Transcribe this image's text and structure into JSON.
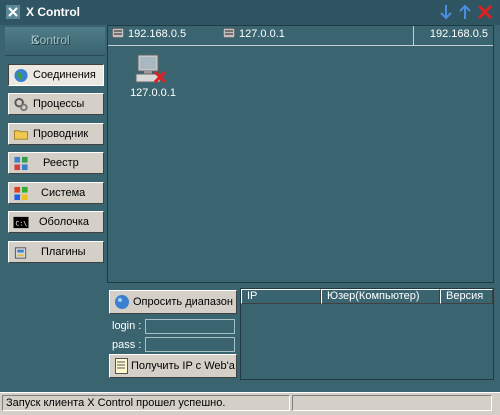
{
  "window": {
    "title": "X Control"
  },
  "title_buttons": {
    "down_icon": "arrow-down-icon",
    "up_icon": "arrow-up-icon",
    "close_icon": "close-icon"
  },
  "logo": {
    "text": "Control"
  },
  "nav": [
    {
      "label": "Соединения",
      "icon": "globe-icon",
      "active": true
    },
    {
      "label": "Процессы",
      "icon": "gears-icon"
    },
    {
      "label": "Проводник",
      "icon": "folder-icon"
    },
    {
      "label": "Реестр",
      "icon": "registry-icon"
    },
    {
      "label": "Система",
      "icon": "windows-icon"
    },
    {
      "label": "Оболочка",
      "icon": "console-icon"
    },
    {
      "label": "Плагины",
      "icon": "plugins-icon"
    }
  ],
  "hosts": {
    "tabs": [
      "192.168.0.5",
      "127.0.0.1"
    ],
    "current": "192.168.0.5"
  },
  "computer": {
    "label": "127.0.0.1",
    "status": "disconnected"
  },
  "scan": {
    "label": "Опросить диапазон"
  },
  "login": {
    "label": "login :",
    "value": ""
  },
  "pass": {
    "label": "pass :",
    "value": ""
  },
  "webip": {
    "label": "Получить IP с Web'а"
  },
  "table": {
    "columns": [
      "IP",
      "Юзер(Компьютер)",
      "Версия"
    ],
    "rows": []
  },
  "status": {
    "message": "Запуск клиента X Control прошел успешно."
  },
  "colors": {
    "panel": "#3a6470",
    "titlebar": "#2f5563",
    "button_face": "#d4d0c8",
    "accent_blue": "#4a90e0",
    "close_red": "#e02020"
  }
}
